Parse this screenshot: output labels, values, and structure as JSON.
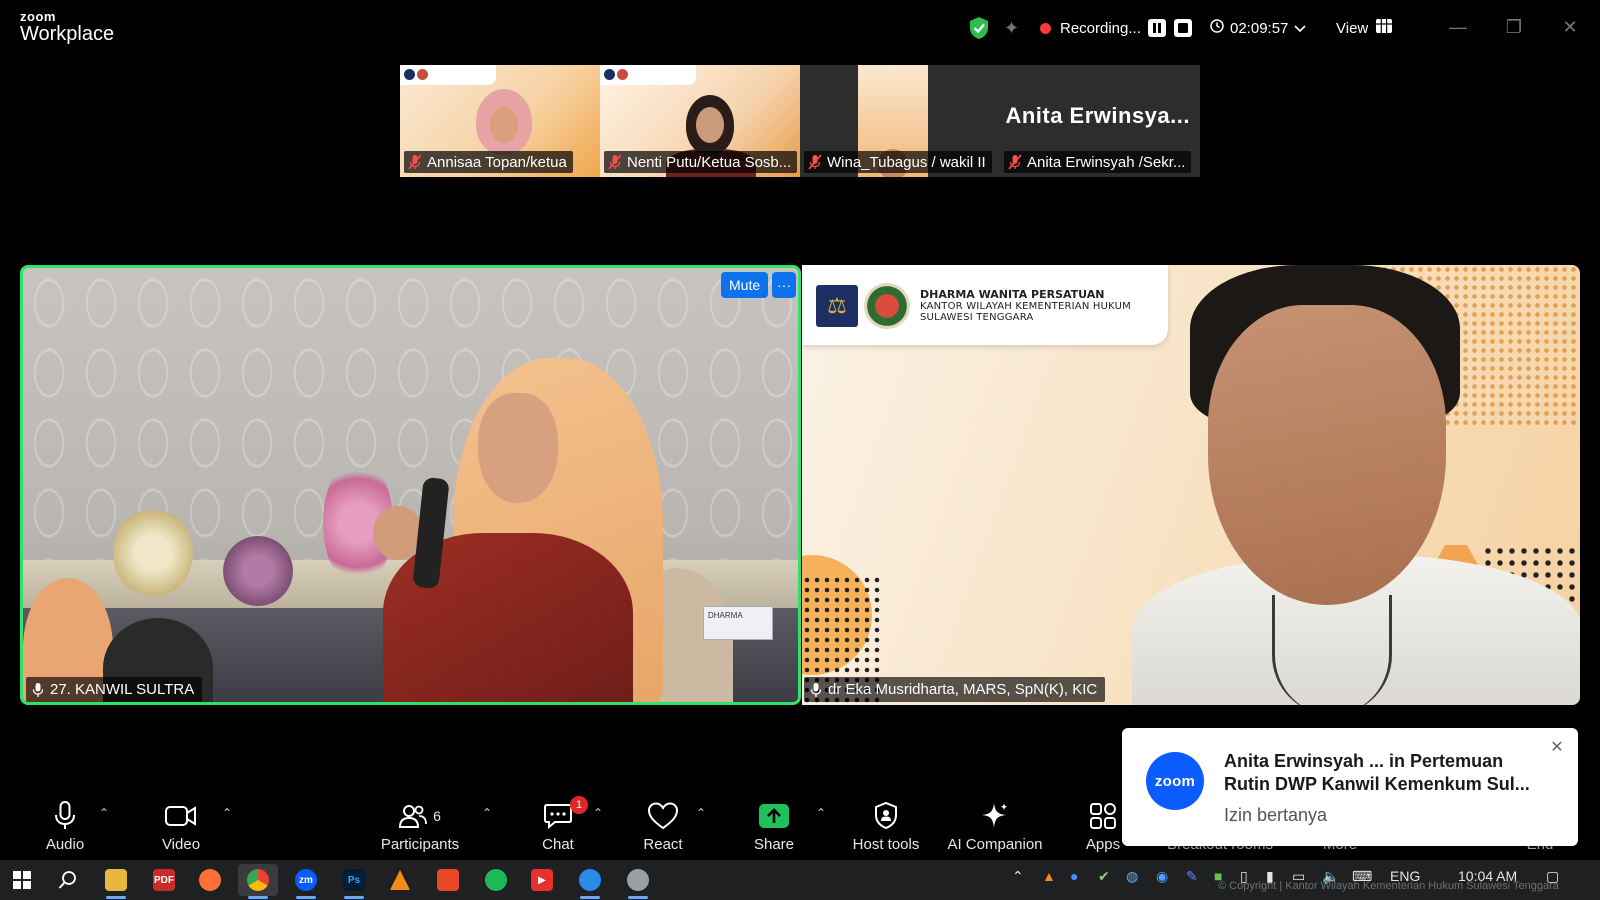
{
  "app": {
    "brand_small": "zoom",
    "brand_large": "Workplace"
  },
  "titlebar": {
    "recording_label": "Recording...",
    "timer": "02:09:57",
    "view_label": "View",
    "icons": [
      "shield-check-icon",
      "sparkle-icon",
      "pause-icon",
      "stop-icon",
      "clock-icon",
      "chevron-down-icon",
      "grid-icon",
      "minimize-icon",
      "restore-icon",
      "close-icon"
    ]
  },
  "thumbnails": [
    {
      "name": "Annisaa Topan/ketua",
      "muted": true
    },
    {
      "name": "Nenti Putu/Ketua Sosb...",
      "muted": true
    },
    {
      "name": "Wina_Tubagus / wakil II",
      "muted": true
    },
    {
      "name": "Anita Erwinsyah /Sekr...",
      "muted": true,
      "display_name": "Anita  Erwinsya..."
    }
  ],
  "main_videos": {
    "left": {
      "name": "27. KANWIL SULTRA",
      "mute_label": "Mute",
      "more_label": "···",
      "plaque_text": "DHARMA"
    },
    "right": {
      "name": "dr Eka Musridharta, MARS, SpN(K), KIC",
      "org_line1": "DHARMA WANITA PERSATUAN",
      "org_line2": "KANTOR WILAYAH KEMENTERIAN HUKUM",
      "org_line3": "SULAWESI TENGGARA"
    }
  },
  "toolbar": {
    "audio": "Audio",
    "video": "Video",
    "participants": "Participants",
    "participants_count": "6",
    "chat": "Chat",
    "chat_badge": "1",
    "react": "React",
    "share": "Share",
    "host_tools": "Host tools",
    "ai_companion": "AI Companion",
    "apps": "Apps",
    "breakout": "Breakout rooms",
    "more": "More",
    "end": "End"
  },
  "notification": {
    "logo": "zoom",
    "title": "Anita Erwinsyah ... in Pertemuan Rutin DWP Kanwil Kemenkum Sul...",
    "message": "Izin bertanya"
  },
  "taskbar": {
    "language": "ENG",
    "time": "10:04 AM",
    "watermark": "© Copyright | Kantor Wilayah Kementerian Hukum Sulawesi Tenggara",
    "apps": [
      "windows-icon",
      "search-icon",
      "file-explorer-icon",
      "pdf-icon",
      "firefox-icon",
      "chrome-icon",
      "zoom-icon",
      "photoshop-icon",
      "vlc-icon",
      "office-icon",
      "spotify-icon",
      "video-app-icon",
      "browser-icon",
      "misc-icon"
    ]
  },
  "colors": {
    "active_speaker_border": "#2ee26a",
    "zoom_blue": "#0e72ed",
    "recording_red": "#ff3b3b",
    "share_green": "#1fc25a",
    "badge_red": "#e02828"
  }
}
